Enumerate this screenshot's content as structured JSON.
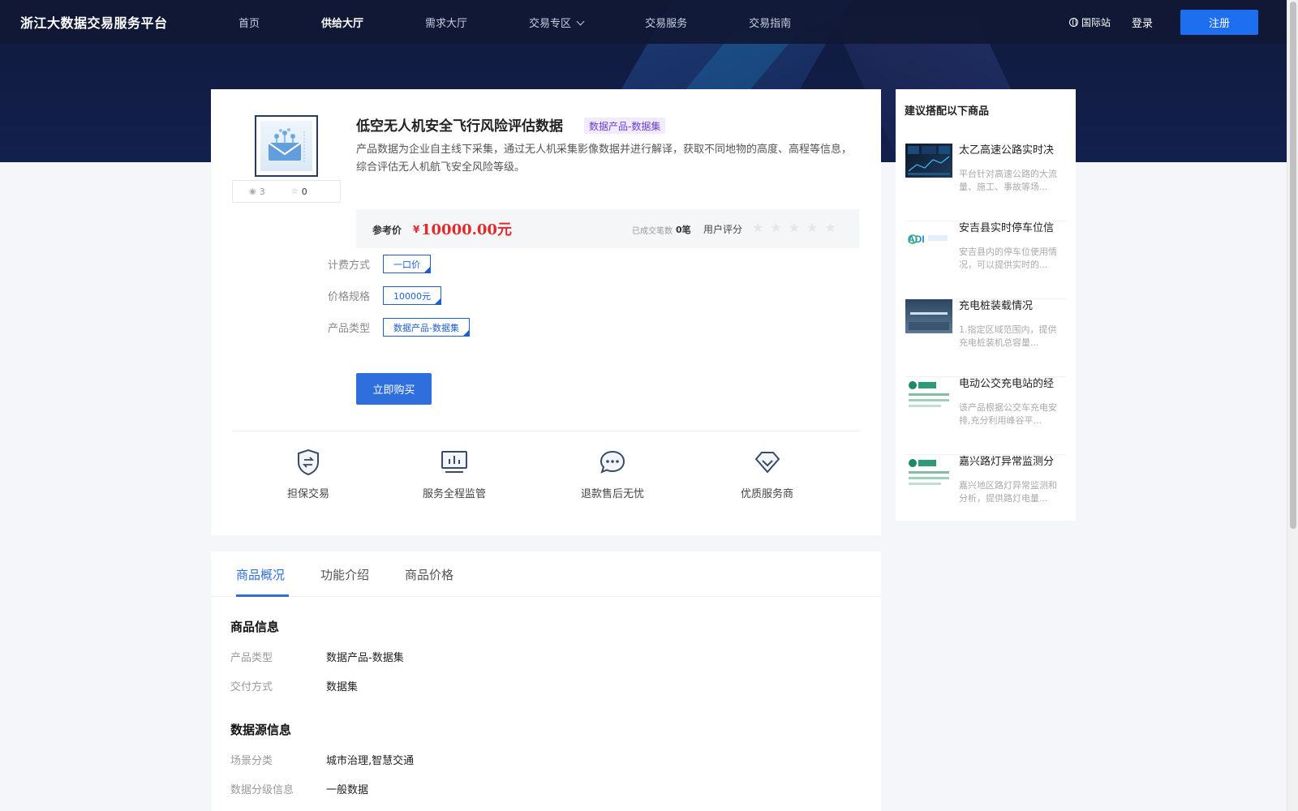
{
  "nav": {
    "brand": "浙江大数据交易服务平台",
    "links": [
      "首页",
      "供给大厅",
      "需求大厅",
      "交易专区",
      "交易服务",
      "交易指南"
    ],
    "international": "国际站",
    "login": "登录",
    "register": "注册"
  },
  "product": {
    "title": "低空无人机安全飞行风险评估数据",
    "tag": "数据产品-数据集",
    "description": "产品数据为企业自主线下采集，通过无人机采集影像数据并进行解译，获取不同地物的高度、高程等信息，综合评估无人机航飞安全风险等级。",
    "views": "3",
    "favorites": "0",
    "price_label": "参考价",
    "currency": "¥",
    "price": "10000.00元",
    "deals_label": "已成交笔数",
    "deals_value": "0笔",
    "rating_label": "用户评分",
    "rating": 0,
    "stars": "★★★★★",
    "options": [
      {
        "label": "计费方式",
        "value": "一口价"
      },
      {
        "label": "价格规格",
        "value": "10000元"
      },
      {
        "label": "产品类型",
        "value": "数据产品-数据集"
      }
    ],
    "buy_label": "立即购买",
    "features": [
      "担保交易",
      "服务全程监管",
      "退款售后无忧",
      "优质服务商"
    ]
  },
  "sidebar": {
    "title": "建议搭配以下商品",
    "items": [
      {
        "title": "太乙高速公路实时决",
        "desc": "平台针对高速公路的大流量、施工、事故等场..."
      },
      {
        "title": "安吉县实时停车位信",
        "desc": "安吉县内的停车位使用情况，可以提供实时的..."
      },
      {
        "title": "充电桩装载情况",
        "desc": "1.指定区域范围内，提供充电桩装机总容量..."
      },
      {
        "title": "电动公交充电站的经",
        "desc": "该产品根据公交车充电安排,充分利用峰谷平..."
      },
      {
        "title": "嘉兴路灯异常监测分",
        "desc": "嘉兴地区路灯异常监测和分析，提供路灯电量..."
      }
    ]
  },
  "detail": {
    "tabs": [
      "商品概况",
      "功能介绍",
      "商品价格"
    ],
    "section1": {
      "title": "商品信息",
      "rows": [
        {
          "k": "产品类型",
          "v": "数据产品-数据集"
        },
        {
          "k": "交付方式",
          "v": "数据集"
        }
      ]
    },
    "section2": {
      "title": "数据源信息",
      "rows": [
        {
          "k": "场景分类",
          "v": "城市治理,智慧交通"
        },
        {
          "k": "数据分级信息",
          "v": "一般数据"
        }
      ]
    }
  },
  "colors": {
    "accent": "#2e6fdd",
    "price": "#e02b2b",
    "nav_bg": "#101a3c",
    "tag": "#6a3ed0"
  }
}
